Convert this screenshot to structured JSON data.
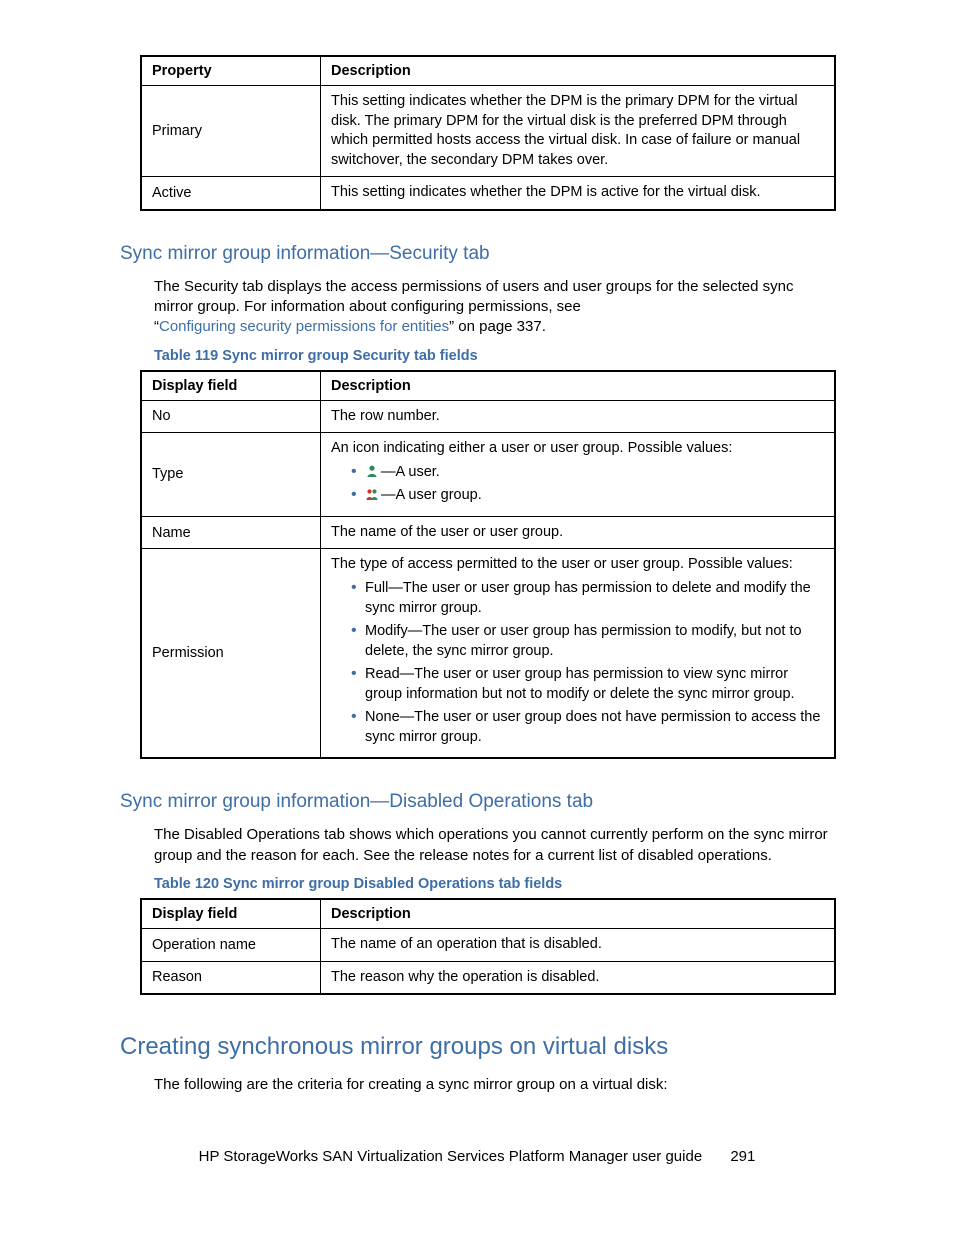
{
  "table118": {
    "headers": {
      "property": "Property",
      "description": "Description"
    },
    "rows": [
      {
        "property": "Primary",
        "description": "This setting indicates whether the DPM is the primary DPM for the virtual disk. The primary DPM for the virtual disk is the preferred DPM through which permitted hosts access the virtual disk. In case of failure or manual switchover, the secondary DPM takes over."
      },
      {
        "property": "Active",
        "description": "This setting indicates whether the DPM is active for the virtual disk."
      }
    ]
  },
  "section_security": {
    "heading": "Sync mirror group information—Security tab",
    "para": "The Security tab displays the access permissions of users and user groups for the selected sync mirror group. For information about configuring permissions, see",
    "link_text": "Configuring security permissions for entities",
    "link_tail": " on page 337.",
    "open_quote": "“",
    "close_quote": "”",
    "table_caption": "Table 119 Sync mirror group Security tab fields"
  },
  "table119": {
    "headers": {
      "display_field": "Display field",
      "description": "Description"
    },
    "rows": {
      "no": {
        "field": "No",
        "desc": "The row number."
      },
      "type": {
        "field": "Type",
        "intro": "An icon indicating either a user or user group. Possible values:",
        "user_text": "—A user.",
        "group_text": "—A user group."
      },
      "name": {
        "field": "Name",
        "desc": "The name of the user or user group."
      },
      "permission": {
        "field": "Permission",
        "intro": "The type of access permitted to the user or user group. Possible values:",
        "items": {
          "full": "Full—The user or user group has permission to delete and modify the sync mirror group.",
          "modify": "Modify—The user or user group has permission to modify, but not to delete, the sync mirror group.",
          "read": "Read—The user or user group has permission to view sync mirror group information but not to modify or delete the sync mirror group.",
          "none": "None—The user or user group does not have permission to access the sync mirror group."
        }
      }
    }
  },
  "section_disabled": {
    "heading": "Sync mirror group information—Disabled Operations tab",
    "para": "The Disabled Operations tab shows which operations you cannot currently perform on the sync mirror group and the reason for each. See the release notes for a current list of disabled operations.",
    "table_caption": "Table 120 Sync mirror group Disabled Operations tab fields"
  },
  "table120": {
    "headers": {
      "display_field": "Display field",
      "description": "Description"
    },
    "rows": [
      {
        "field": "Operation name",
        "desc": "The name of an operation that is disabled."
      },
      {
        "field": "Reason",
        "desc": "The reason why the operation is disabled."
      }
    ]
  },
  "section_creating": {
    "heading": "Creating synchronous mirror groups on virtual disks",
    "para": "The following are the criteria for creating a sync mirror group on a virtual disk:"
  },
  "footer": {
    "title": "HP StorageWorks SAN Virtualization Services Platform Manager user guide",
    "page": "291"
  }
}
